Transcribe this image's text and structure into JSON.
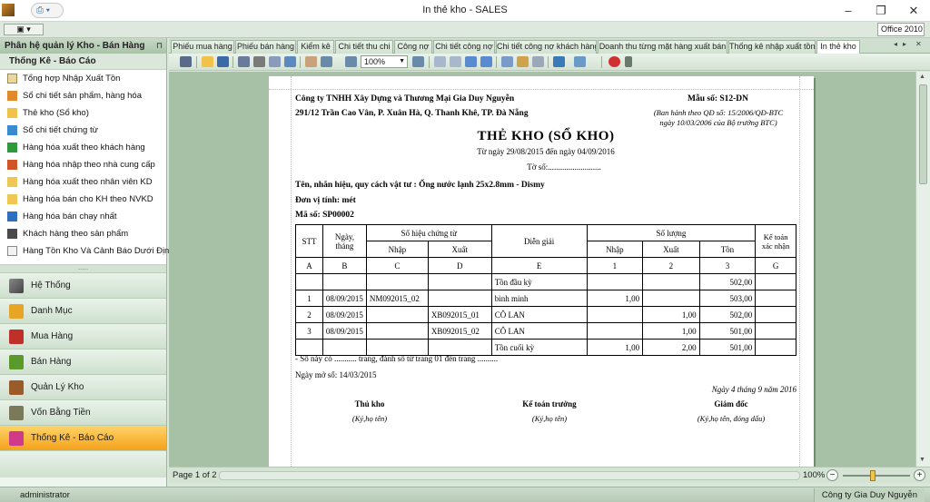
{
  "window": {
    "title": "In thẻ kho - SALES",
    "qat_label": "▾",
    "theme": "Office 2010"
  },
  "leftpanel": {
    "header": "Phân hệ quản lý Kho - Bán Hàng",
    "section": "Thống Kê - Báo Cáo",
    "items": [
      {
        "label": "Tổng hợp Nhập Xuất Tồn",
        "icon": "list-icon"
      },
      {
        "label": "Sổ chi tiết sản phẩm, hàng hóa",
        "icon": "book-icon"
      },
      {
        "label": "Thẻ kho (Sổ kho)",
        "icon": "card-icon"
      },
      {
        "label": "Sổ chi tiết chứng từ",
        "icon": "document-icon"
      },
      {
        "label": "Hàng hóa xuất theo khách hàng",
        "icon": "export-icon"
      },
      {
        "label": "Hàng hóa nhập theo nhà cung cấp",
        "icon": "import-icon"
      },
      {
        "label": "Hàng hóa xuất theo nhân viên KD",
        "icon": "folder-icon"
      },
      {
        "label": "Hàng hóa bán cho KH theo NVKD",
        "icon": "folder-icon"
      },
      {
        "label": "Hàng hóa bán chạy nhất",
        "icon": "chart-icon"
      },
      {
        "label": "Khách hàng theo sản phẩm",
        "icon": "customer-icon"
      },
      {
        "label": "Hàng Tồn Kho Và Cảnh Báo Dưới Định Mức",
        "icon": "warning-icon"
      }
    ],
    "nav": [
      {
        "label": "Hệ Thống",
        "icon": "tools-icon",
        "active": false
      },
      {
        "label": "Danh Mục",
        "icon": "star-icon",
        "active": false
      },
      {
        "label": "Mua Hàng",
        "icon": "purchase-icon",
        "active": false
      },
      {
        "label": "Bán Hàng",
        "icon": "sales-icon",
        "active": false
      },
      {
        "label": "Quản Lý Kho",
        "icon": "warehouse-icon",
        "active": false
      },
      {
        "label": "Vốn Bằng Tiền",
        "icon": "money-icon",
        "active": false
      },
      {
        "label": "Thống Kê - Báo Cáo",
        "icon": "report-icon",
        "active": true
      }
    ]
  },
  "tabs": [
    "Phiếu mua hàng",
    "Phiếu bán hàng",
    "Kiểm kê",
    "Chi tiết thu chi",
    "Công nợ",
    "Chi tiết công nợ",
    "Chi tiết công nợ khách hàng",
    "Doanh thu từng mặt hàng xuất bán",
    "Thống kê nhập xuất tồn",
    "In thẻ kho"
  ],
  "toolbar": {
    "zoom": "100%"
  },
  "report": {
    "company": "Công ty TNHH Xây Dựng và Thương Mại Gia Duy Nguyễn",
    "address": "291/12 Trần Cao Vân, P. Xuân Hà, Q. Thanh Khê, TP. Đà Nẵng",
    "form_no": "Mẫu số: S12-DN",
    "decision_line1": "(Ban hành theo QĐ số: 15/2006/QĐ-BTC",
    "decision_line2": "ngày 10/03/2006 của Bộ trưởng BTC)",
    "title": "THẺ KHO (SỔ KHO)",
    "date_range": "Từ ngày 29/08/2015 đến ngày 04/09/2016",
    "sheet_no": "Tờ số:..........................",
    "product": "Tên, nhãn hiệu, quy cách vật tư :    Ống nước lạnh 25x2.8mm - Dismy",
    "unit": "Đơn vị tính:  mét",
    "code": "Mã số:     SP00002",
    "headers": {
      "stt": "STT",
      "date": "Ngày, tháng",
      "voucher": "Số hiệu chứng từ",
      "voucher_in": "Nhập",
      "voucher_out": "Xuất",
      "desc": "Diễn giải",
      "qty": "Số lượng",
      "qty_in": "Nhập",
      "qty_out": "Xuất",
      "qty_bal": "Tồn",
      "confirm": "Kế toán xác nhận"
    },
    "letters": [
      "A",
      "B",
      "C",
      "D",
      "E",
      "1",
      "2",
      "3",
      "G"
    ],
    "rows": [
      {
        "stt": "",
        "date": "",
        "vin": "",
        "vout": "",
        "desc": "Tồn đầu kỳ",
        "qin": "",
        "qout": "",
        "bal": "502,00"
      },
      {
        "stt": "1",
        "date": "08/09/2015",
        "vin": "NM092015_02",
        "vout": "",
        "desc": "bình minh",
        "qin": "1,00",
        "qout": "",
        "bal": "503,00"
      },
      {
        "stt": "2",
        "date": "08/09/2015",
        "vin": "",
        "vout": "XB092015_01",
        "desc": "CÔ LAN",
        "qin": "",
        "qout": "1,00",
        "bal": "502,00"
      },
      {
        "stt": "3",
        "date": "08/09/2015",
        "vin": "",
        "vout": "XB092015_02",
        "desc": "CÔ LAN",
        "qin": "",
        "qout": "1,00",
        "bal": "501,00"
      },
      {
        "stt": "",
        "date": "",
        "vin": "",
        "vout": "",
        "desc": "Tồn cuối kỳ",
        "qin": "1,00",
        "qout": "2,00",
        "bal": "501,00"
      }
    ],
    "note_pages": "- Sổ này có ........... trang, đánh số từ trang 01 đến trang ..........",
    "note_open": "Ngày mở sổ: 14/03/2015",
    "sign_date": "Ngày 4 tháng 9 năm 2016",
    "signers": [
      {
        "role": "Thủ kho",
        "hint": "(Ký,họ tên)"
      },
      {
        "role": "Kế toán trưởng",
        "hint": "(Ký,họ tên)"
      },
      {
        "role": "Giám đốc",
        "hint": "(Ký,họ tên, đóng dấu)"
      }
    ]
  },
  "pagebar": {
    "page": "Page 1 of 2",
    "zoom": "100%"
  },
  "status": {
    "user": "administrator",
    "company": "Công ty Gia Duy Nguyễn"
  }
}
